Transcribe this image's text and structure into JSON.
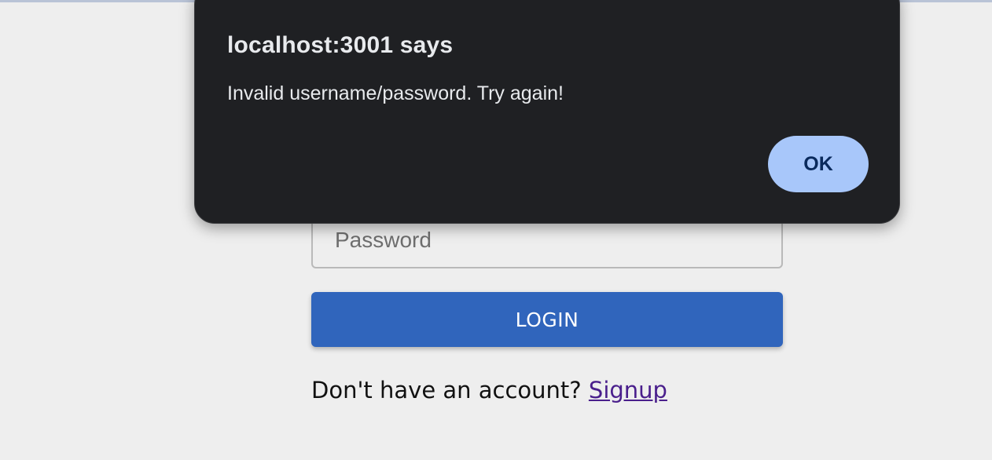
{
  "login": {
    "password_placeholder": "Password",
    "login_button_label": "LOGIN",
    "signup_prompt": "Don't have an account?",
    "signup_link_label": "Signup"
  },
  "alert": {
    "title": "localhost:3001 says",
    "message": "Invalid username/password. Try again!",
    "ok_label": "OK"
  },
  "colors": {
    "page_background": "#eeeeee",
    "primary_button": "#3065bc",
    "dialog_background": "#1f2023",
    "ok_button": "#a8c7fa",
    "link": "#4a1f8c"
  }
}
